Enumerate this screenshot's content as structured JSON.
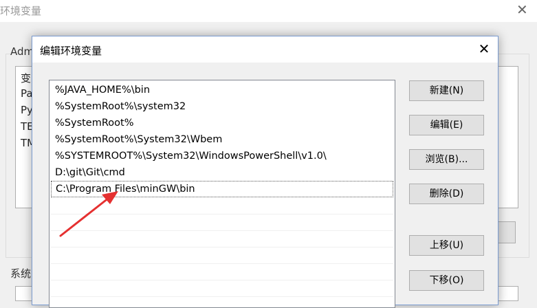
{
  "background_window": {
    "title": "环境变量",
    "user_group_label": "Adm",
    "user_rows": [
      "变",
      "Pa",
      "Py",
      "TE",
      "TM"
    ],
    "system_group_label": "系统"
  },
  "dialog": {
    "title": "编辑环境变量",
    "path_entries": [
      "%JAVA_HOME%\\bin",
      "%SystemRoot%\\system32",
      "%SystemRoot%",
      "%SystemRoot%\\System32\\Wbem",
      "%SYSTEMROOT%\\System32\\WindowsPowerShell\\v1.0\\",
      "D:\\git\\Git\\cmd",
      "C:\\Program Files\\minGW\\bin"
    ],
    "selected_index": 6,
    "buttons": {
      "new": "新建(N)",
      "edit": "编辑(E)",
      "browse": "浏览(B)...",
      "delete": "删除(D)",
      "move_up": "上移(U)",
      "move_down": "下移(O)"
    }
  },
  "colors": {
    "annotation_arrow": "#e53030"
  }
}
